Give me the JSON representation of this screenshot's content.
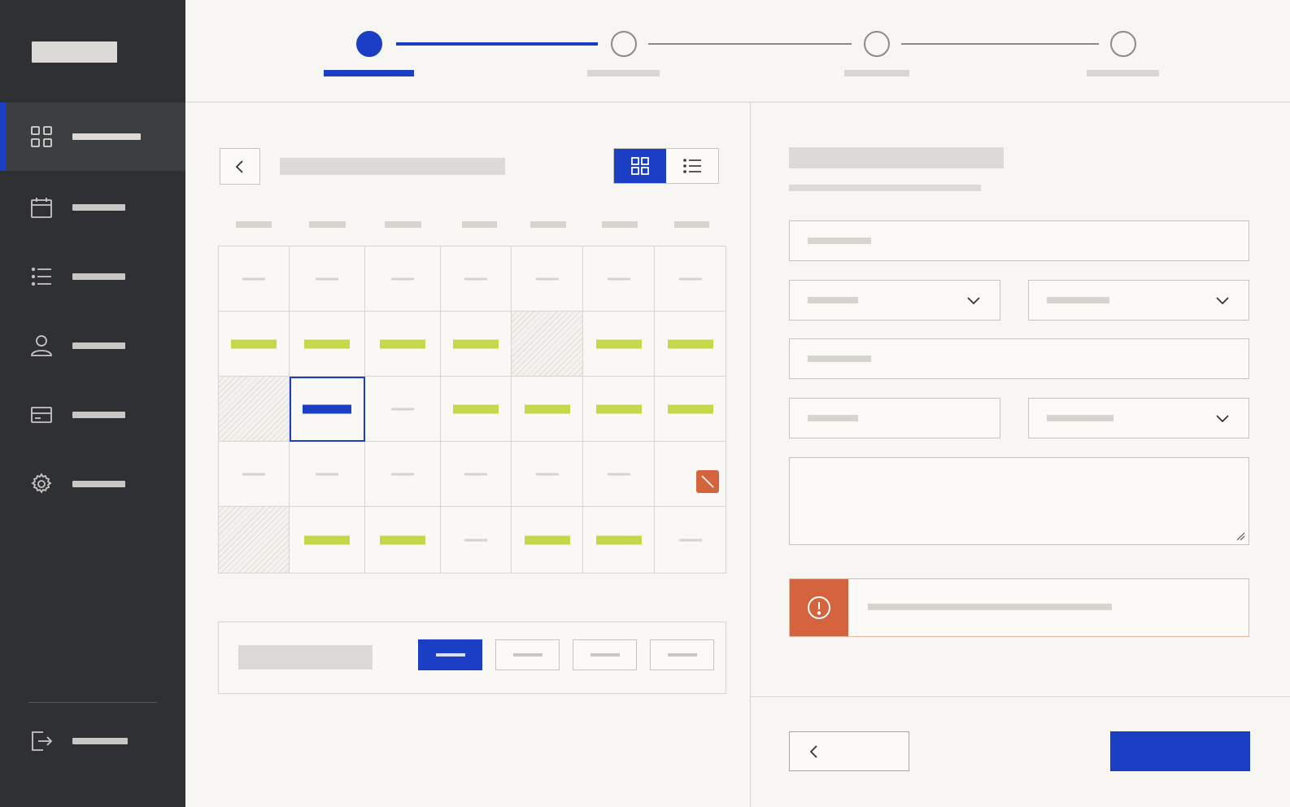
{
  "colors": {
    "sidebar_bg": "#2e3033",
    "accent": "#1a3fc4",
    "available": "#c4d84a",
    "warning": "#d4643e",
    "surface": "#f7f6f3"
  },
  "sidebar": {
    "items": [
      {
        "icon": "grid-icon",
        "active": true
      },
      {
        "icon": "calendar-icon",
        "active": false
      },
      {
        "icon": "list-icon",
        "active": false
      },
      {
        "icon": "user-icon",
        "active": false
      },
      {
        "icon": "card-icon",
        "active": false
      },
      {
        "icon": "gear-icon",
        "active": false
      }
    ],
    "footer_item": {
      "icon": "logout-icon"
    }
  },
  "stepper": {
    "total_steps": 4,
    "current_step": 1
  },
  "calendar": {
    "view_options": [
      "grid-icon",
      "list-icon"
    ],
    "active_view": "grid",
    "weeks": [
      [
        "empty",
        "empty",
        "empty",
        "empty",
        "empty",
        "empty",
        "empty"
      ],
      [
        "available",
        "available",
        "available",
        "available",
        "blocked",
        "available",
        "available"
      ],
      [
        "blocked",
        "selected",
        "empty",
        "available",
        "available",
        "available",
        "available"
      ],
      [
        "empty",
        "empty",
        "empty",
        "empty",
        "empty",
        "empty",
        "unavailable"
      ],
      [
        "blocked",
        "available",
        "available",
        "empty",
        "available",
        "available",
        "empty"
      ]
    ],
    "time_slots": {
      "count": 4,
      "active_index": 0
    }
  },
  "form": {
    "fields": [
      {
        "type": "text"
      },
      {
        "type": "select"
      },
      {
        "type": "select"
      },
      {
        "type": "text"
      },
      {
        "type": "text"
      },
      {
        "type": "select"
      },
      {
        "type": "textarea"
      }
    ],
    "alert": {
      "icon": "exclamation-circle-icon"
    }
  },
  "footer": {
    "prev_icon": "chevron-left-icon"
  }
}
